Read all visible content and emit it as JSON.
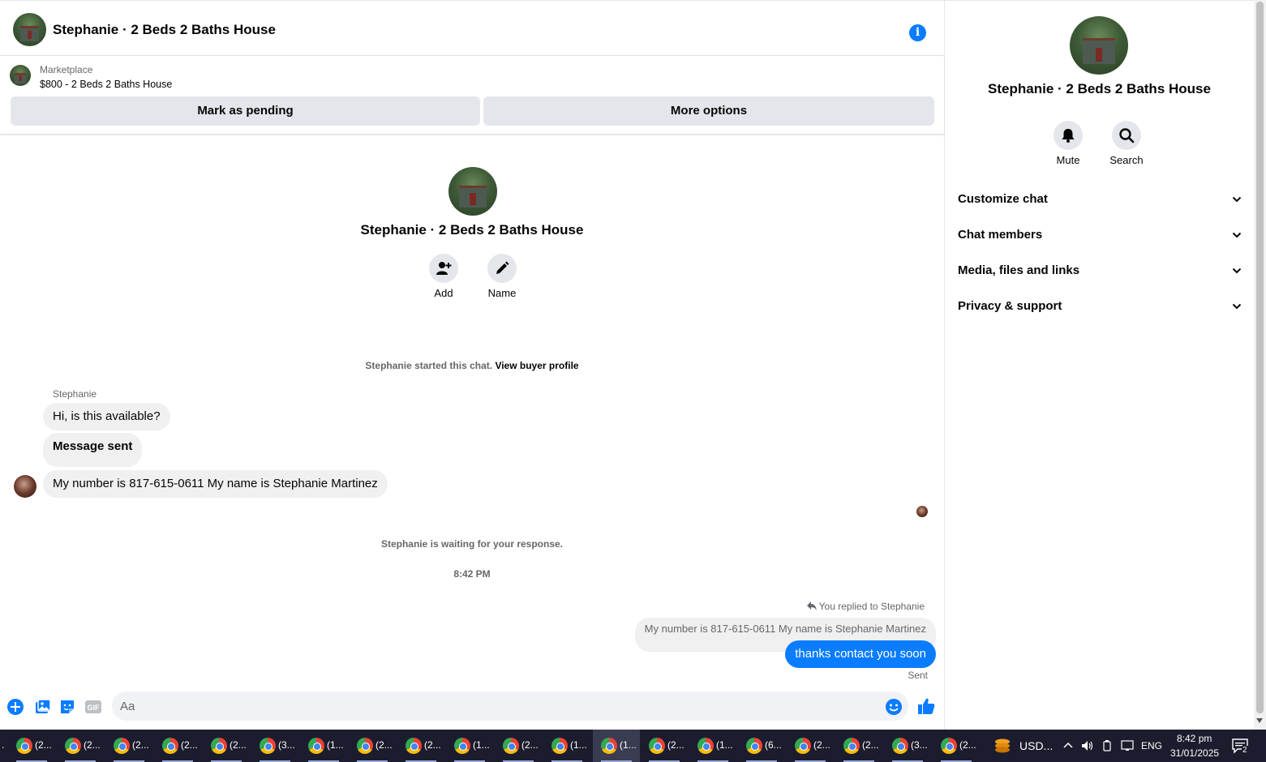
{
  "header": {
    "title": "Stephanie · 2 Beds 2 Baths House"
  },
  "marketplace": {
    "label": "Marketplace",
    "listing": "$800 - 2 Beds 2 Baths House",
    "mark_pending": "Mark as pending",
    "more_options": "More options"
  },
  "intro": {
    "title": "Stephanie · 2 Beds 2 Baths House",
    "add_label": "Add",
    "name_label": "Name"
  },
  "system": {
    "started_text": "Stephanie started this chat.",
    "view_profile": "View buyer profile",
    "waiting": "Stephanie is waiting for your response.",
    "time": "8:42 PM"
  },
  "messages": {
    "sender": "Stephanie",
    "m1": "Hi, is this available?",
    "m2": "Message sent",
    "m3": "My number is 817-615-0611 My name is Stephanie Martinez",
    "reply_note": "You replied to Stephanie",
    "quoted": "My number is 817-615-0611 My name is Stephanie Martinez",
    "out": "thanks contact you soon",
    "status": "Sent"
  },
  "composer": {
    "placeholder": "Aa"
  },
  "info_panel": {
    "title": "Stephanie · 2 Beds 2 Baths House",
    "mute": "Mute",
    "search": "Search",
    "sections": [
      "Customize chat",
      "Chat members",
      "Media, files and links",
      "Privacy & support"
    ]
  },
  "taskbar": {
    "items": [
      "(2...",
      "(2...",
      "(2...",
      "(2...",
      "(2...",
      "(3...",
      "(1...",
      "(2...",
      "(2...",
      "(1...",
      "(2...",
      "(1...",
      "(1...",
      "(2...",
      "(1...",
      "(6...",
      "(2...",
      "(2...",
      "(3...",
      "(2..."
    ],
    "currency": "USD...",
    "language": "ENG",
    "time": "8:42 pm",
    "date": "31/01/2025",
    "notifications": "2"
  },
  "colors": {
    "accent": "#0a7cff",
    "bubble_in": "#f0f0f0",
    "button_bg": "#e4e6eb",
    "taskbar": "#1b1d2e"
  }
}
